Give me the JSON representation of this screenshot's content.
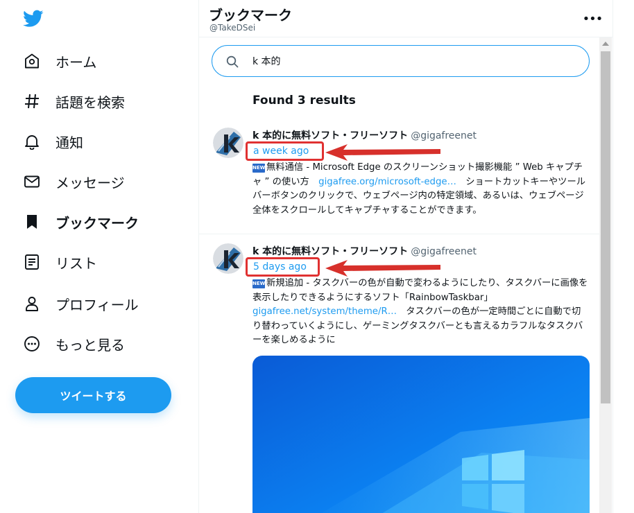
{
  "sidebar": {
    "items": [
      {
        "label": "ホーム",
        "icon": "home-icon"
      },
      {
        "label": "話題を検索",
        "icon": "hashtag-icon"
      },
      {
        "label": "通知",
        "icon": "bell-icon"
      },
      {
        "label": "メッセージ",
        "icon": "envelope-icon"
      },
      {
        "label": "ブックマーク",
        "icon": "bookmark-icon",
        "active": true
      },
      {
        "label": "リスト",
        "icon": "list-icon"
      },
      {
        "label": "プロフィール",
        "icon": "person-icon"
      },
      {
        "label": "もっと見る",
        "icon": "more-circle-icon"
      }
    ],
    "tweet_button": "ツイートする"
  },
  "header": {
    "title": "ブックマーク",
    "handle": "@TakeDSei",
    "more": "•••"
  },
  "search": {
    "value": "k 本的"
  },
  "results": {
    "count_label": "Found 3 results"
  },
  "tweets": [
    {
      "author": "k 本的に無料ソフト・フリーソフト",
      "handle": "@gigafreenet",
      "time": "a week ago",
      "badge": "NEW",
      "text_a": "無料通信 - Microsoft Edge のスクリーンショット撮影機能 ” Web キャプチャ ” の使い方　",
      "link": "gigafree.org/microsoft-edge…",
      "text_b": "　ショートカットキーやツールバーボタンのクリックで、ウェブページ内の特定領域、あるいは、ウェブページ全体をスクロールしてキャプチャすることができます。"
    },
    {
      "author": "k 本的に無料ソフト・フリーソフト",
      "handle": "@gigafreenet",
      "time": "5 days ago",
      "badge": "NEW",
      "text_a": "新規追加 - タスクバーの色が自動で変わるようにしたり、タスクバーに画像を表示したりできるようにするソフト「RainbowTaskbar」 ",
      "link": "gigafree.net/system/theme/R…",
      "text_b": "　タスクバーの色が一定時間ごとに自動で切り替わっていくようにし、ゲーミングタスクバーとも言えるカラフルなタスクバーを楽しめるように"
    }
  ],
  "colors": {
    "accent": "#1d9bf0",
    "highlight": "#e03131",
    "text": "#0f1419",
    "muted": "#536471"
  }
}
